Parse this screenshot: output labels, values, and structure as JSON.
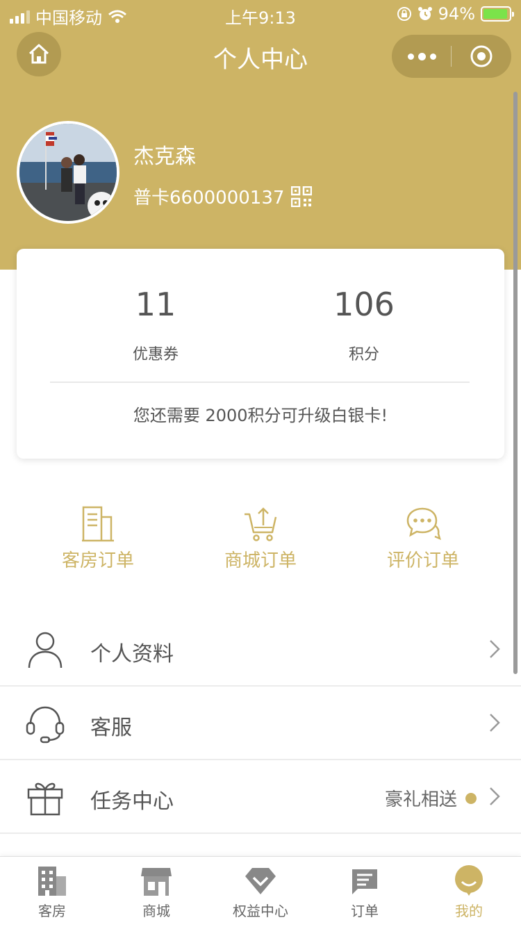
{
  "status_bar": {
    "carrier": "中国移动",
    "time": "上午9:13",
    "battery": "94%"
  },
  "nav": {
    "title": "个人中心"
  },
  "profile": {
    "name": "杰克森",
    "card_number": "普卡6600000137"
  },
  "stats": {
    "coupons": {
      "value": "11",
      "label": "优惠券"
    },
    "points": {
      "value": "106",
      "label": "积分"
    },
    "upgrade_text": "您还需要 2000积分可升级白银卡!"
  },
  "orders": [
    {
      "label": "客房订单",
      "icon": "room-order-icon"
    },
    {
      "label": "商城订单",
      "icon": "cart-order-icon"
    },
    {
      "label": "评价订单",
      "icon": "review-chat-icon"
    }
  ],
  "menu": [
    {
      "label": "个人资料",
      "icon": "user-icon"
    },
    {
      "label": "客服",
      "icon": "headset-icon"
    },
    {
      "label": "任务中心",
      "icon": "gift-icon",
      "extra": "豪礼相送"
    }
  ],
  "tabs": [
    {
      "label": "客房",
      "icon": "building-icon"
    },
    {
      "label": "商城",
      "icon": "store-icon"
    },
    {
      "label": "权益中心",
      "icon": "diamond-icon"
    },
    {
      "label": "订单",
      "icon": "order-list-icon"
    },
    {
      "label": "我的",
      "icon": "smile-icon",
      "active": true
    }
  ],
  "colors": {
    "brand_gold": "#cdb465",
    "capsule_gold": "#b29b52",
    "battery_green": "#7be34a"
  }
}
